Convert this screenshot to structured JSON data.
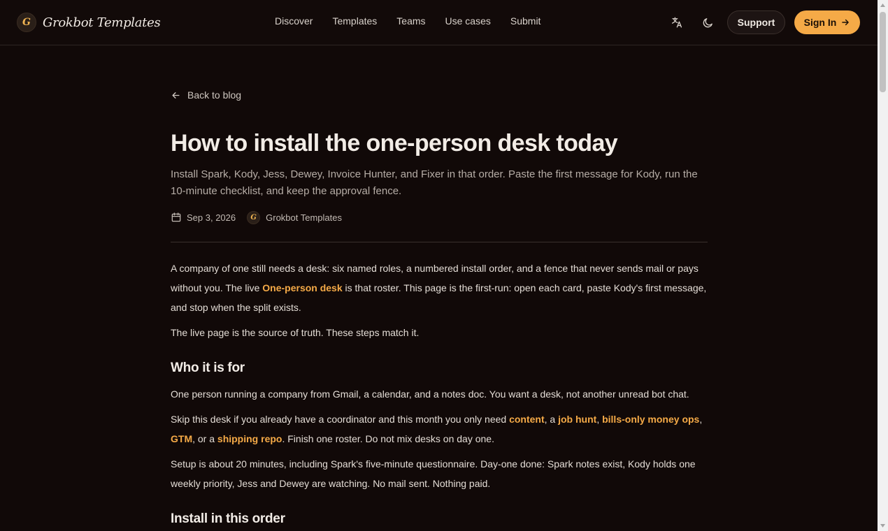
{
  "header": {
    "logo_letter": "G",
    "brand": "Grokbot Templates",
    "nav": [
      "Discover",
      "Templates",
      "Teams",
      "Use cases",
      "Submit"
    ],
    "support_label": "Support",
    "signin_label": "Sign In"
  },
  "article": {
    "back_label": "Back to blog",
    "title": "How to install the one-person desk today",
    "subtitle": "Install Spark, Kody, Jess, Dewey, Invoice Hunter, and Fixer in that order. Paste the first message for Kody, run the 10-minute checklist, and keep the approval fence.",
    "date": "Sep 3, 2026",
    "author_logo_letter": "G",
    "author": "Grokbot Templates",
    "p1": {
      "before": "A company of one still needs a desk: six named roles, a numbered install order, and a fence that never sends mail or pays without you. The live ",
      "link": "One-person desk",
      "after": " is that roster. This page is the first-run: open each card, paste Kody's first message, and stop when the split exists."
    },
    "p2": "The live page is the source of truth. These steps match it.",
    "h2_who": "Who it is for",
    "p3": "One person running a company from Gmail, a calendar, and a notes doc. You want a desk, not another unread bot chat.",
    "p4": {
      "t1": "Skip this desk if you already have a coordinator and this month you only need ",
      "l1": "content",
      "t2": ", a ",
      "l2": "job hunt",
      "t3": ", ",
      "l3": "bills-only money ops",
      "t4": ", ",
      "l4": "GTM",
      "t5": ", or a ",
      "l5": "shipping repo",
      "t6": ". Finish one roster. Do not mix desks on day one."
    },
    "p5": "Setup is about 20 minutes, including Spark's five-minute questionnaire. Day-one done: Spark notes exist, Kody holds one weekly priority, Jess and Dewey are watching. No mail sent. Nothing paid.",
    "h2_install": "Install in this order"
  },
  "colors": {
    "background": "#110908",
    "accent": "#f5aa47"
  },
  "icons": [
    "translate-icon",
    "moon-icon",
    "arrow-right-icon",
    "arrow-left-icon",
    "calendar-icon"
  ]
}
